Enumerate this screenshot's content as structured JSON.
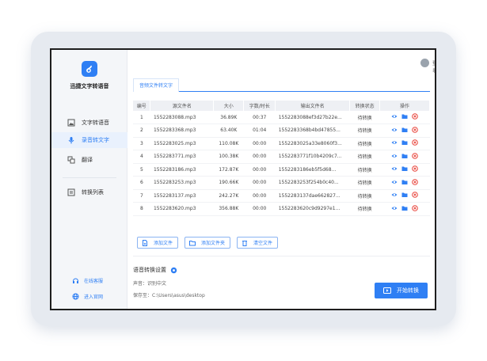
{
  "app": {
    "name": "迅捷文字转语音"
  },
  "sidebar": {
    "items": [
      {
        "label": "文字转语音",
        "icon": "image-file-icon",
        "active": false
      },
      {
        "label": "录音转文字",
        "icon": "microphone-icon",
        "active": true
      },
      {
        "label": "翻译",
        "icon": "translate-icon",
        "active": false
      },
      {
        "label": "转换列表",
        "icon": "list-icon",
        "active": false
      }
    ],
    "links": [
      {
        "label": "在线客服",
        "icon": "headset-icon"
      },
      {
        "label": "进入官网",
        "icon": "globe-icon"
      }
    ]
  },
  "titlebar": {
    "login_label": "登录",
    "controls": [
      "minimize",
      "maximize",
      "close"
    ]
  },
  "tab": {
    "label": "音频文件转文字"
  },
  "table": {
    "headers": [
      "编号",
      "源文件名",
      "大小",
      "字数/时长",
      "输出文件名",
      "转换状态",
      "操作"
    ],
    "rows": [
      {
        "id": "1",
        "name": "1552283088.mp3",
        "size": "36.89K",
        "duration": "00:37",
        "output": "1552283088ef3d27b22e...",
        "status": "待转换"
      },
      {
        "id": "2",
        "name": "1552283368.mp3",
        "size": "63.40K",
        "duration": "01:04",
        "output": "1552283368b4bd47855...",
        "status": "待转换"
      },
      {
        "id": "3",
        "name": "1552283025.mp3",
        "size": "110.08K",
        "duration": "00:00",
        "output": "1552283025a33e8060f3...",
        "status": "待转换"
      },
      {
        "id": "4",
        "name": "1552283771.mp3",
        "size": "100.38K",
        "duration": "00:00",
        "output": "1552283771f10b4209c7...",
        "status": "待转换"
      },
      {
        "id": "5",
        "name": "1552283186.mp3",
        "size": "172.87K",
        "duration": "00:00",
        "output": "1552283186eb5f5d68...",
        "status": "待转换"
      },
      {
        "id": "6",
        "name": "1552283253.mp3",
        "size": "190.66K",
        "duration": "00:00",
        "output": "1552283253f254b0c40...",
        "status": "待转换"
      },
      {
        "id": "7",
        "name": "1552283137.mp3",
        "size": "242.27K",
        "duration": "00:00",
        "output": "1552283137dae662827...",
        "status": "待转换"
      },
      {
        "id": "8",
        "name": "1552283620.mp3",
        "size": "356.88K",
        "duration": "00:00",
        "output": "1552283620c9d9297e1...",
        "status": "待转换"
      }
    ]
  },
  "buttons": {
    "add_file": "添加文件",
    "add_folder": "添加文件夹",
    "clear_files": "清空文件"
  },
  "settings": {
    "title": "语音转换设置",
    "voice_label": "声音：",
    "voice_value": "识别中文",
    "save_label": "保存至：",
    "save_path": "C:\\Users\\asus\\desktop"
  },
  "start_button": "开始转换",
  "colors": {
    "accent": "#2f7ff4",
    "danger": "#e8433a"
  }
}
